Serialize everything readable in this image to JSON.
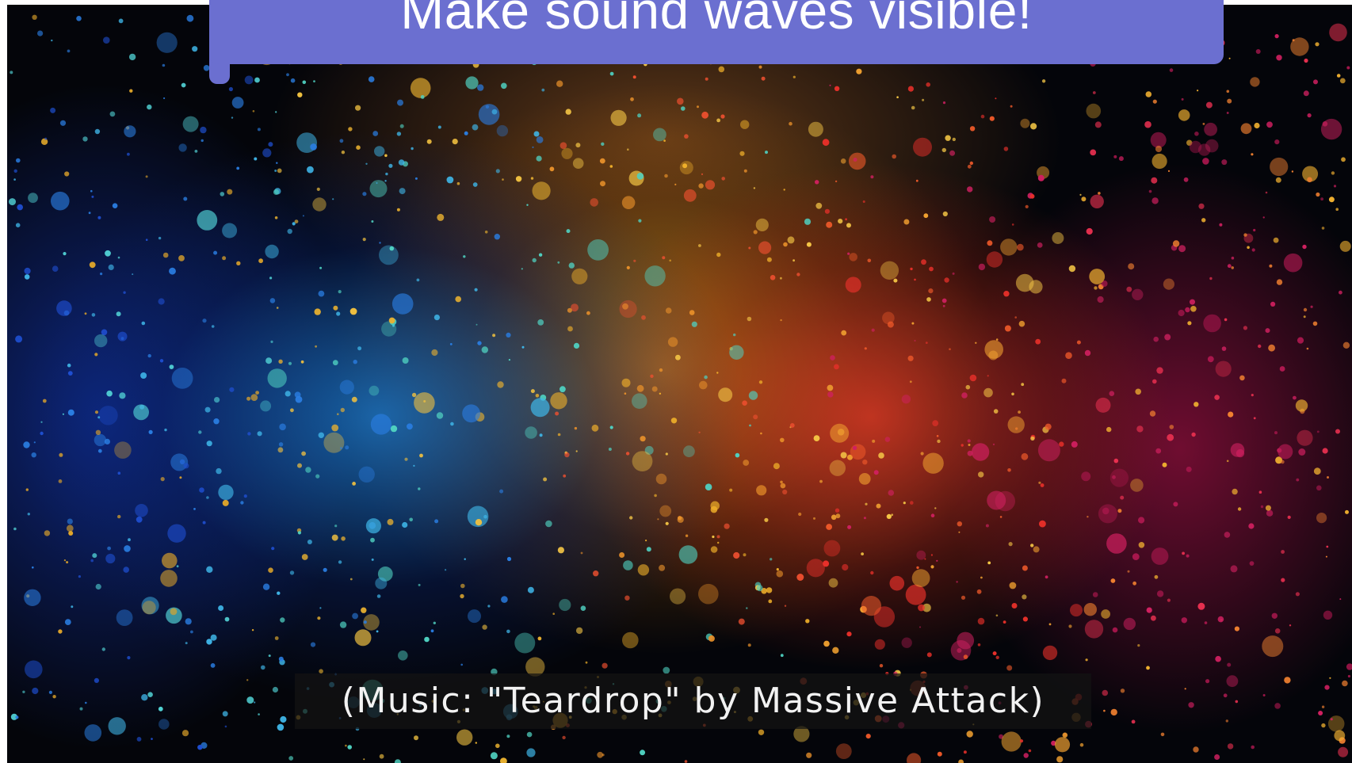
{
  "banner": {
    "title": "Make sound waves visible!",
    "color": "#6b6fd0"
  },
  "video": {
    "caption": "(Music: \"Teardrop\" by Massive Attack)",
    "colors": {
      "left": "#1e82dc",
      "center": "#e6a01e",
      "right": "#f03c28",
      "far_right": "#c81450",
      "background": "#04050a"
    }
  }
}
